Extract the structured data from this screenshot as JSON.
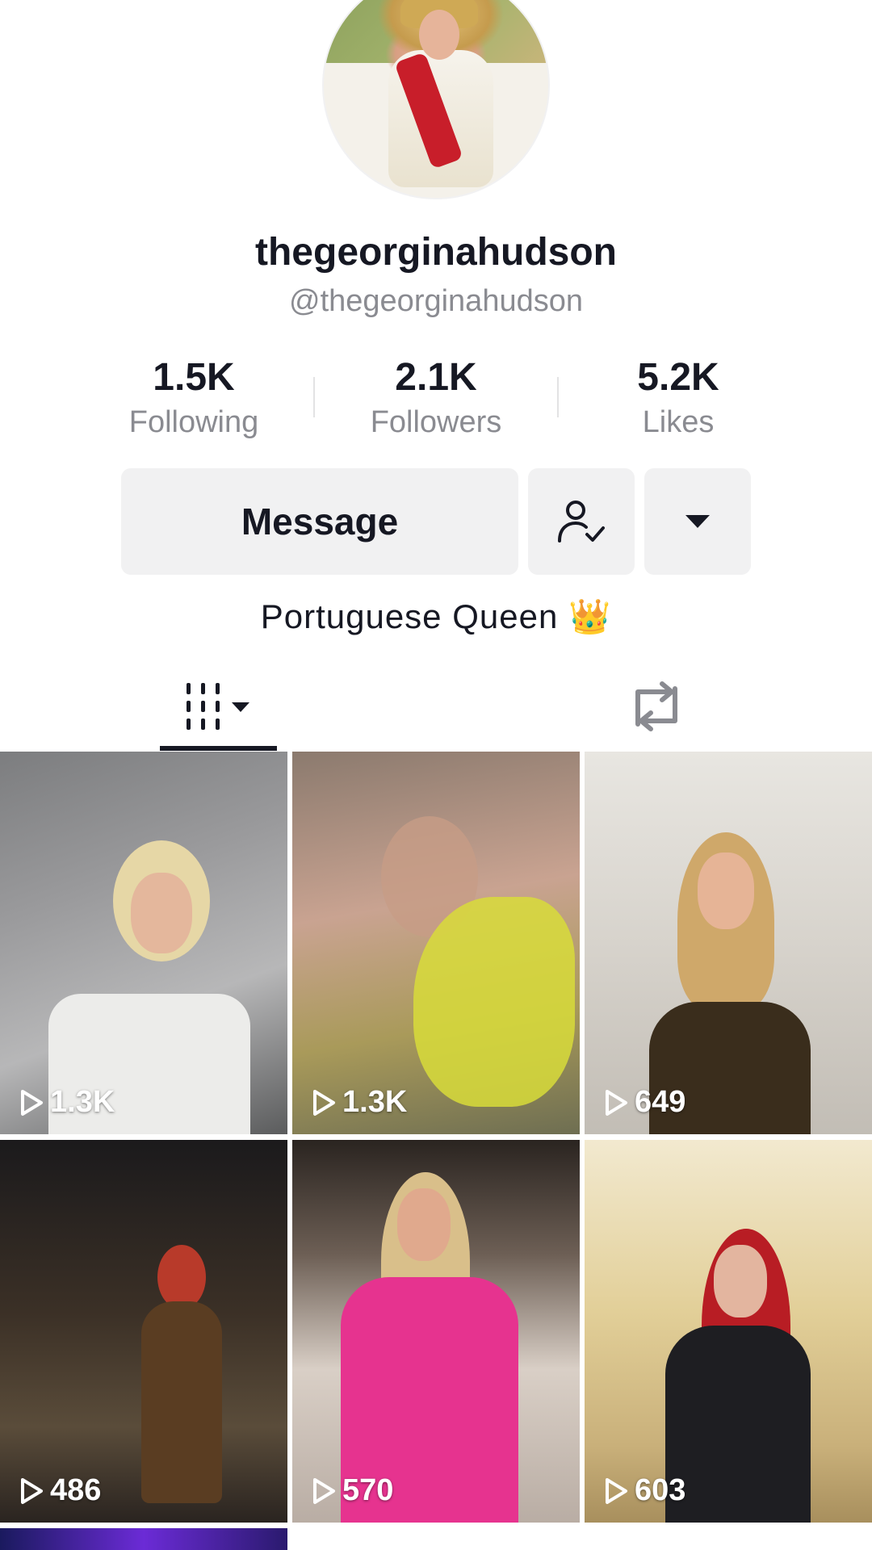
{
  "profile": {
    "display_name": "thegeorginahudson",
    "handle": "@thegeorginahudson",
    "bio": "Portuguese Queen 👑"
  },
  "stats": {
    "following": {
      "value": "1.5K",
      "label": "Following"
    },
    "followers": {
      "value": "2.1K",
      "label": "Followers"
    },
    "likes": {
      "value": "5.2K",
      "label": "Likes"
    }
  },
  "actions": {
    "message_label": "Message",
    "follow_icon": "user-check-icon",
    "more_icon": "caret-down-icon"
  },
  "tabs": [
    {
      "icon": "videos-grid-icon",
      "active": true
    },
    {
      "icon": "repost-icon",
      "active": false
    }
  ],
  "videos": [
    {
      "views": "1.3K"
    },
    {
      "views": "1.3K"
    },
    {
      "views": "649"
    },
    {
      "views": "486"
    },
    {
      "views": "570"
    },
    {
      "views": "603"
    }
  ],
  "colors": {
    "text": "#161823",
    "muted": "#8a8b91",
    "button_bg": "#f1f1f2"
  }
}
